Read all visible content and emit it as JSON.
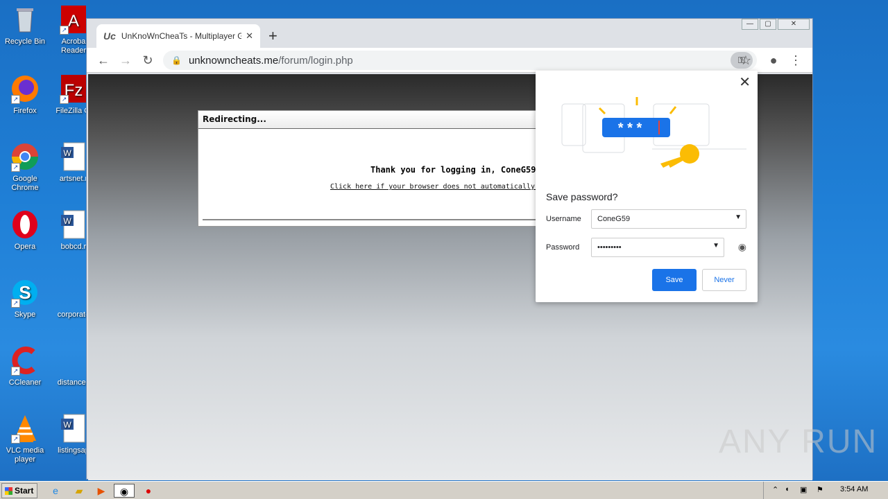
{
  "desktop": {
    "icons": [
      {
        "label": "Recycle Bin",
        "icon": "recycle-bin-icon"
      },
      {
        "label": "Acroba Reader",
        "icon": "acrobat-icon"
      },
      {
        "label": "Firefox",
        "icon": "firefox-icon"
      },
      {
        "label": "FileZilla Cl",
        "icon": "filezilla-icon"
      },
      {
        "label": "Google Chrome",
        "icon": "chrome-icon"
      },
      {
        "label": "artsnet.r",
        "icon": "word-doc-icon"
      },
      {
        "label": "Opera",
        "icon": "opera-icon"
      },
      {
        "label": "bobcd.r",
        "icon": "word-doc-icon"
      },
      {
        "label": "Skype",
        "icon": "skype-icon"
      },
      {
        "label": "corporate",
        "icon": "file-icon"
      },
      {
        "label": "CCleaner",
        "icon": "ccleaner-icon"
      },
      {
        "label": "distances",
        "icon": "file-icon"
      },
      {
        "label": "VLC media player",
        "icon": "vlc-icon"
      },
      {
        "label": "listingsap",
        "icon": "word-doc-icon"
      }
    ]
  },
  "browser": {
    "tab_title": "UnKnoWnCheaTs - Multiplayer Game",
    "tab_favicon": "Uc",
    "url_domain": "unknowncheats.me",
    "url_path": "/forum/login.php"
  },
  "page": {
    "redirect_header": "Redirecting...",
    "message": "Thank you for logging in, ConeG59.",
    "link_text": "Click here if your browser does not automatically redi"
  },
  "save_password": {
    "title": "Save password?",
    "username_label": "Username",
    "username_value": "ConeG59",
    "password_label": "Password",
    "password_value": "•••••••••",
    "illus_text": "* * *",
    "save_label": "Save",
    "never_label": "Never"
  },
  "watermark": "ANY RUN",
  "taskbar": {
    "start_label": "Start",
    "time": "3:54 AM"
  },
  "colors": {
    "accent": "#1a73e8",
    "desktop": "#1f7fd6"
  }
}
